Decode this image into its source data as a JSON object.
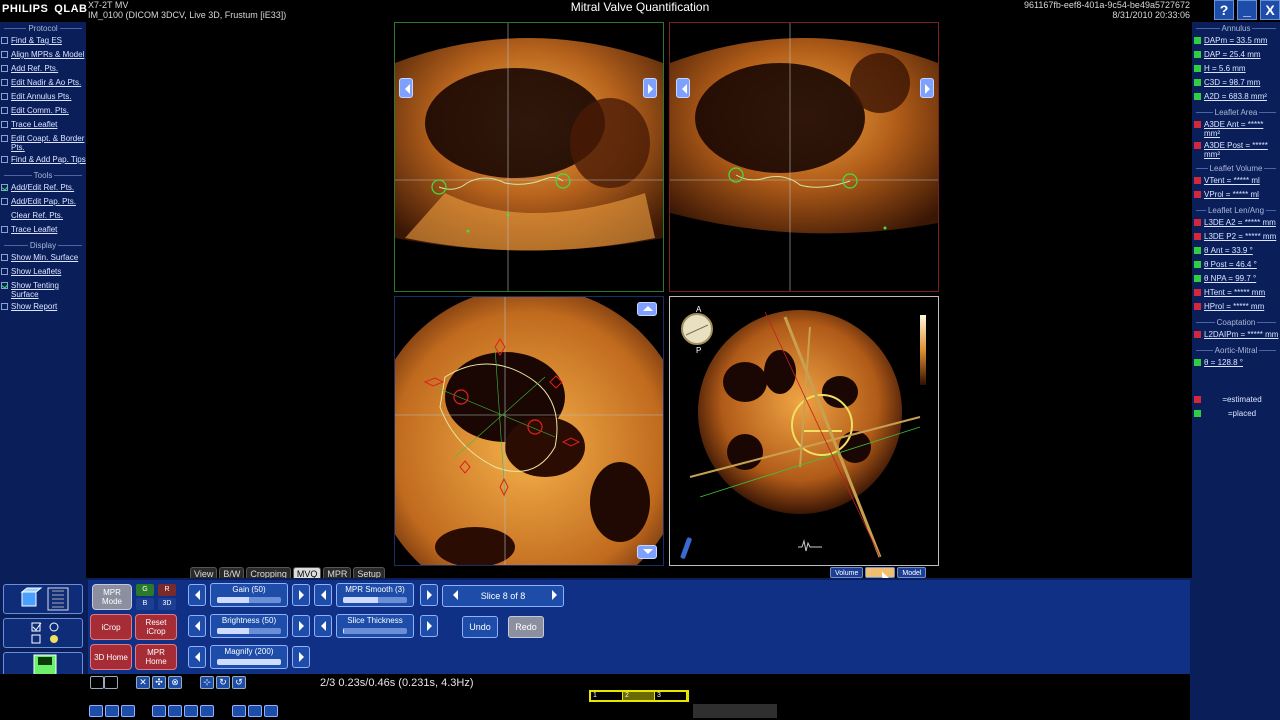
{
  "brand": {
    "left": "PHILIPS",
    "right": "QLAB"
  },
  "probe": {
    "line1": "X7-2T MV",
    "line2": "IM_0100 (DICOM 3DCV, Live 3D, Frustum [iE33])"
  },
  "app_title": "Mitral Valve Quantification",
  "session": {
    "id": "961167fb-eef8-401a-9c54-be49a5727672",
    "datetime": "8/31/2010 20:33:06"
  },
  "window_buttons": {
    "help": "?",
    "minimize": "_",
    "close": "X"
  },
  "left_panel": {
    "protocol_header": "Protocol",
    "protocol_items": [
      {
        "label": "Find & Tag ES",
        "checked": false
      },
      {
        "label": "Align MPRs & Model",
        "checked": false
      },
      {
        "label": "Add Ref. Pts.",
        "checked": false
      },
      {
        "label": "Edit Nadir & Ao Pts.",
        "checked": false
      },
      {
        "label": "Edit Annulus Pts.",
        "checked": false
      },
      {
        "label": "Edit Comm. Pts.",
        "checked": false
      },
      {
        "label": "Trace Leaflet",
        "checked": false
      },
      {
        "label": "Edit Coapt. & Border Pts.",
        "checked": false
      },
      {
        "label": "Find & Add Pap. Tips",
        "checked": false
      }
    ],
    "tools_header": "Tools",
    "tools_items": [
      {
        "label": "Add/Edit Ref. Pts.",
        "checked": true
      },
      {
        "label": "Add/Edit Pap. Pts.",
        "checked": false
      },
      {
        "label": "Clear Ref. Pts.",
        "checked": null
      },
      {
        "label": "Trace Leaflet",
        "checked": false
      }
    ],
    "display_header": "Display",
    "display_items": [
      {
        "label": "Show Min. Surface",
        "checked": false
      },
      {
        "label": "Show Leaflets",
        "checked": false
      },
      {
        "label": "Show Tenting Surface",
        "checked": true
      },
      {
        "label": "Show Report",
        "checked": false
      }
    ]
  },
  "right_panel": {
    "annulus_header": "Annulus",
    "annulus_items": [
      {
        "label": "DAPm = 33.5 mm",
        "status": "green"
      },
      {
        "label": "DAP = 25.4 mm",
        "status": "green"
      },
      {
        "label": "H = 5.6 mm",
        "status": "green"
      },
      {
        "label": "C3D = 98.7 mm",
        "status": "green"
      },
      {
        "label": "A2D = 683.8 mm²",
        "status": "green"
      }
    ],
    "leaflet_area_header": "Leaflet Area",
    "leaflet_area_items": [
      {
        "label": "A3DE Ant = ***** mm²",
        "status": "red"
      },
      {
        "label": "A3DE Post = ***** mm²",
        "status": "red"
      }
    ],
    "leaflet_volume_header": "Leaflet Volume",
    "leaflet_volume_items": [
      {
        "label": "VTent = ***** ml",
        "status": "red"
      },
      {
        "label": "VProl = ***** ml",
        "status": "red"
      }
    ],
    "leaflet_len_header": "Leaflet Len/Ang",
    "leaflet_len_items": [
      {
        "label": "L3DE A2 = ***** mm",
        "status": "red"
      },
      {
        "label": "L3DE P2 = ***** mm",
        "status": "red"
      },
      {
        "label": "θ Ant = 33.9 °",
        "status": "green"
      },
      {
        "label": "θ Post = 46.4 °",
        "status": "green"
      },
      {
        "label": "θ NPA = 99.7 °",
        "status": "green"
      },
      {
        "label": "HTent = ***** mm",
        "status": "red"
      },
      {
        "label": "HProl = ***** mm",
        "status": "red"
      }
    ],
    "coaptation_header": "Coaptation",
    "coaptation_items": [
      {
        "label": "L2DAIPm = ***** mm",
        "status": "red"
      }
    ],
    "aortic_header": "Aortic-Mitral",
    "aortic_items": [
      {
        "label": "θ = 128.8 °",
        "status": "green"
      }
    ],
    "legend": [
      {
        "label": "=estimated",
        "status": "red"
      },
      {
        "label": "=placed",
        "status": "green"
      }
    ]
  },
  "viewer": {
    "orientation_top": "A",
    "orientation_bottom": "P"
  },
  "tabs": [
    "View",
    "B/W",
    "Cropping",
    "MVQ",
    "MPR",
    "Setup"
  ],
  "active_tab": "MVQ",
  "view_buttons": [
    "Volume",
    "",
    "Model"
  ],
  "controls": {
    "mpr_mode": "MPR Mode",
    "color_buttons": [
      "G",
      "R",
      "B",
      "3D"
    ],
    "icrop": "iCrop",
    "reset_icrop": "Reset iCrop",
    "home_3d": "3D Home",
    "mpr_home": "MPR Home",
    "gain": {
      "label": "Gain (50)",
      "level": 0.5
    },
    "brightness": {
      "label": "Brightness (50)",
      "level": 0.5
    },
    "magnify": {
      "label": "Magnify (200)",
      "level": 1.0
    },
    "mpr_smooth": {
      "label": "MPR Smooth (3)",
      "level": 0.55
    },
    "slice_thickness": {
      "label": "Slice Thickness",
      "level": 0.02
    },
    "slice": "Slice 8 of 8",
    "undo": "Undo",
    "redo": "Redo"
  },
  "status": {
    "frame_info": "2/3  0.23s/0.46s (0.231s, 4.3Hz)",
    "timeline": [
      "1",
      "2",
      "3"
    ],
    "current_frame": 2
  }
}
